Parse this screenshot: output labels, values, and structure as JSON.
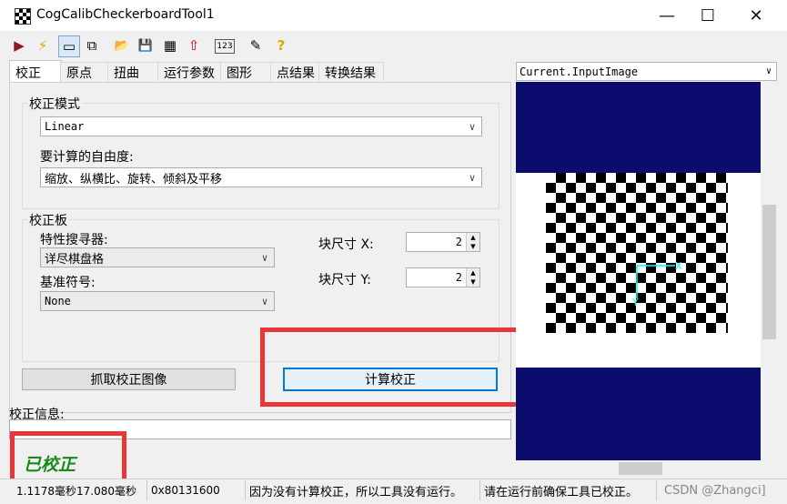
{
  "window": {
    "title": "CogCalibCheckerboardTool1",
    "minimize": "—",
    "maximize": "☐",
    "close": "✕"
  },
  "toolbar": {
    "icons": [
      "run-icon",
      "lightning-icon",
      "image-icon",
      "copy-image-icon",
      "open-folder-icon",
      "save-icon",
      "grid-icon",
      "import-icon",
      "display-123-icon",
      "edit-icon",
      "help-icon"
    ],
    "glyphs": [
      "▶",
      "⚡",
      "▭",
      "⧉",
      "📂",
      "💾",
      "▦",
      "⇧",
      "123",
      "✎",
      "?"
    ]
  },
  "tabs": [
    "校正",
    "原点",
    "扭曲",
    "运行参数",
    "图形",
    "点结果",
    "转换结果"
  ],
  "calib_mode": {
    "group_label": "校正模式",
    "value": "Linear"
  },
  "dof": {
    "label": "要计算的自由度:",
    "value": "缩放、纵横比、旋转、倾斜及平移"
  },
  "board": {
    "group_label": "校正板",
    "finder_label": "特性搜寻器:",
    "finder_value": "详尽棋盘格",
    "fiducial_label": "基准符号:",
    "fiducial_value": "None",
    "tile_x_label": "块尺寸 X:",
    "tile_x_value": "2",
    "tile_y_label": "块尺寸 Y:",
    "tile_y_value": "2"
  },
  "buttons": {
    "grab": "抓取校正图像",
    "compute": "计算校正"
  },
  "info": {
    "label": "校正信息:",
    "status": "已校正",
    "input_value": ""
  },
  "image": {
    "selector": "Current.InputImage"
  },
  "statusbar": {
    "time": "1.1178毫秒17.080毫秒",
    "code": "0x80131600",
    "msg1": "因为没有计算校正，所以工具没有运行。",
    "msg2": "请在运行前确保工具已校正。",
    "watermark": "CSDN @Zhangci]"
  },
  "colors": {
    "highlight": "#e8373b",
    "status_text": "#1a8a1a",
    "image_bg": "#0c0c6e"
  }
}
